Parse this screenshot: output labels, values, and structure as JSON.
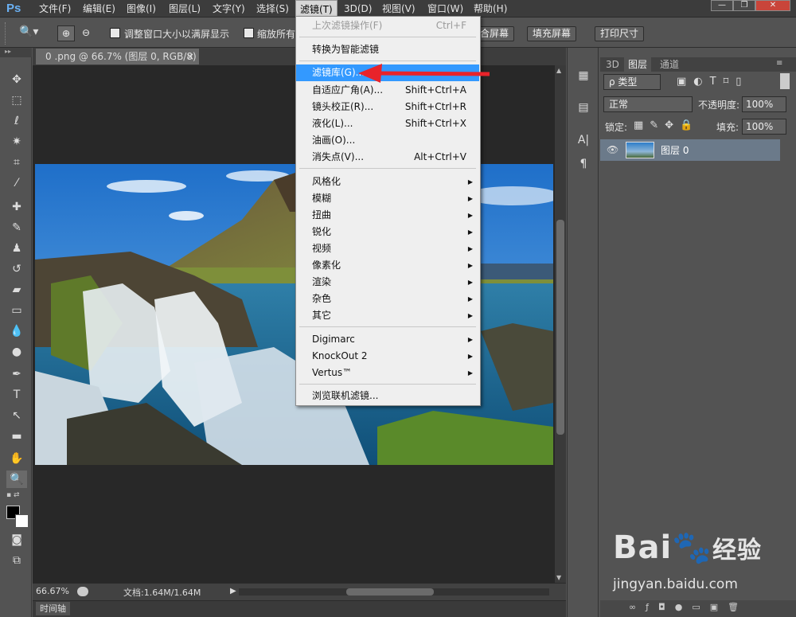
{
  "app": {
    "logo": "Ps"
  },
  "menubar": {
    "items": [
      "文件(F)",
      "编辑(E)",
      "图像(I)",
      "图层(L)",
      "文字(Y)",
      "选择(S)",
      "滤镜(T)",
      "3D(D)",
      "视图(V)",
      "窗口(W)",
      "帮助(H)"
    ],
    "active": "滤镜(T)"
  },
  "window_controls": {
    "minimize": "—",
    "restore": "❐",
    "close": "✕"
  },
  "options_bar": {
    "checkbox1_label": "调整窗口大小以满屏显示",
    "checkbox2_label": "缩放所有",
    "btn_fit_screen": "合屏幕",
    "btn_fill_screen": "填充屏幕",
    "btn_print_size": "打印尺寸"
  },
  "document": {
    "tab_title": "0 .png @ 66.7% (图层 0, RGB/8)",
    "tab_close": "×",
    "zoom": "66.67%",
    "doc_info": "文档:1.64M/1.64M"
  },
  "timeline": {
    "label": "时间轴"
  },
  "layers_panel": {
    "tabs": [
      "3D",
      "图层",
      "通道"
    ],
    "active_tab": "图层",
    "filter_kind": "ρ 类型",
    "blend_mode": "正常",
    "opacity_label": "不透明度:",
    "opacity_value": "100%",
    "lock_label": "锁定:",
    "fill_label": "填充:",
    "fill_value": "100%",
    "layer_name": "图层 0"
  },
  "filter_menu": {
    "last_filter": {
      "label": "上次滤镜操作(F)",
      "shortcut": "Ctrl+F"
    },
    "smart": "转换为智能滤镜",
    "gallery": "滤镜库(G)...",
    "adaptive_wide": {
      "label": "自适应广角(A)...",
      "shortcut": "Shift+Ctrl+A"
    },
    "lens_correction": {
      "label": "镜头校正(R)...",
      "shortcut": "Shift+Ctrl+R"
    },
    "liquify": {
      "label": "液化(L)...",
      "shortcut": "Shift+Ctrl+X"
    },
    "oil_paint": "油画(O)...",
    "vanishing_point": {
      "label": "消失点(V)...",
      "shortcut": "Alt+Ctrl+V"
    },
    "submenus": [
      "风格化",
      "模糊",
      "扭曲",
      "锐化",
      "视频",
      "像素化",
      "渲染",
      "杂色",
      "其它"
    ],
    "plugins": [
      "Digimarc",
      "KnockOut 2",
      "Vertus™"
    ],
    "browse_online": "浏览联机滤镜..."
  },
  "watermark": {
    "brand": "Bai",
    "brand2": "经验",
    "url": "jingyan.baidu.com"
  },
  "colors": {
    "highlight": "#3399ff",
    "arrow": "#e8232a"
  }
}
